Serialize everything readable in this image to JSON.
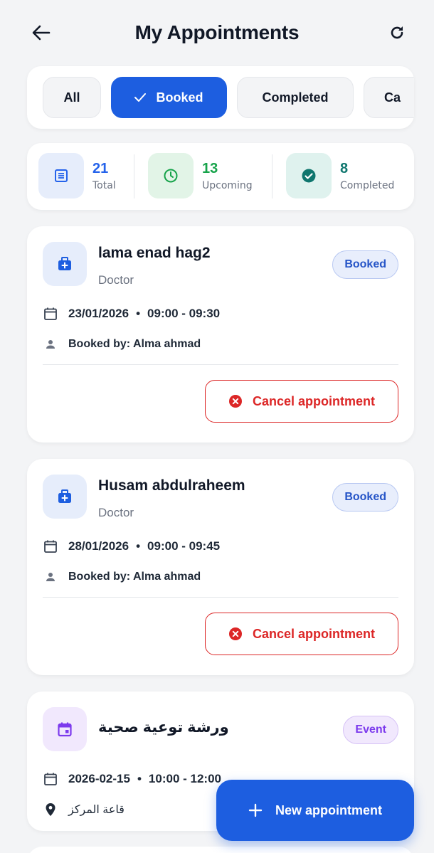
{
  "header": {
    "title": "My Appointments",
    "back_icon": "arrow-left-icon",
    "refresh_icon": "refresh-icon"
  },
  "filters": [
    {
      "label": "All",
      "active": false
    },
    {
      "label": "Booked",
      "active": true
    },
    {
      "label": "Completed",
      "active": false
    },
    {
      "label": "Ca",
      "active": false
    }
  ],
  "stats": {
    "total": {
      "value": "21",
      "label": "Total",
      "color": "#2563eb"
    },
    "upcoming": {
      "value": "13",
      "label": "Upcoming",
      "color": "#16a34a"
    },
    "completed": {
      "value": "8",
      "label": "Completed",
      "color": "#0f766e"
    }
  },
  "appointments": [
    {
      "name": "lama enad hag2",
      "role": "Doctor",
      "status": "Booked",
      "date": "23/01/2026",
      "time": "09:00 - 09:30",
      "booked_by": "Booked by: Alma ahmad",
      "action": "Cancel appointment"
    },
    {
      "name": "Husam abdulraheem",
      "role": "Doctor",
      "status": "Booked",
      "date": "28/01/2026",
      "time": "09:00 - 09:45",
      "booked_by": "Booked by: Alma ahmad",
      "action": "Cancel appointment"
    },
    {
      "name": "ورشة توعية صحية",
      "status": "Event",
      "date": "2026-02-15",
      "time": "10:00 - 12:00",
      "location": "قاعة المركز"
    }
  ],
  "fab": {
    "label": "New appointment"
  },
  "colors": {
    "primary": "#1d5ee0",
    "danger": "#dc2626",
    "event": "#7c3aed"
  }
}
